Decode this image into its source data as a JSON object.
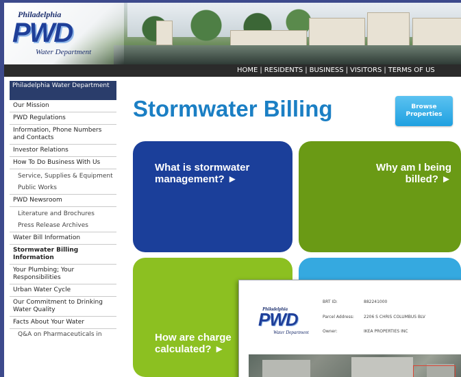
{
  "header": {
    "logo": {
      "top": "Philadelphia",
      "main": "PWD",
      "bottom": "Water Department"
    },
    "nav": [
      "HOME",
      "RESIDENTS",
      "BUSINESS",
      "VISITORS",
      "TERMS OF US"
    ]
  },
  "sidebar": {
    "heading": "Philadelphia Water Department",
    "items": [
      {
        "label": "Our Mission",
        "sub": false
      },
      {
        "label": "PWD Regulations",
        "sub": false
      },
      {
        "label": "Information, Phone Numbers and Contacts",
        "sub": false
      },
      {
        "label": "Investor Relations",
        "sub": false
      },
      {
        "label": "How To Do Business With Us",
        "sub": false
      },
      {
        "label": "Service, Supplies & Equipment",
        "sub": true
      },
      {
        "label": "Public Works",
        "sub": true
      },
      {
        "label": "PWD Newsroom",
        "sub": false
      },
      {
        "label": "Literature and Brochures",
        "sub": true
      },
      {
        "label": "Press Release Archives",
        "sub": true
      },
      {
        "label": "Water Bill Information",
        "sub": false
      },
      {
        "label": "Stormwater Billing Information",
        "sub": false,
        "active": true
      },
      {
        "label": "Your Plumbing; Your Responsibilities",
        "sub": false
      },
      {
        "label": "Urban Water Cycle",
        "sub": false
      },
      {
        "label": "Our Commitment to Drinking Water Quality",
        "sub": false
      },
      {
        "label": "Facts About Your Water",
        "sub": false
      },
      {
        "label": "Q&A on Pharmaceuticals in",
        "sub": true
      }
    ]
  },
  "main": {
    "title": "Stormwater Billing",
    "browse_button": "Browse Properties",
    "tiles": [
      {
        "text": "What is stormwater management? ►",
        "color": "#1b3f9a"
      },
      {
        "text": "Why am I being billed? ►",
        "color": "#6a9a15"
      },
      {
        "text": "How are charge calculated? ►",
        "color": "#8cc021"
      },
      {
        "text": "",
        "color": "#35a9e0"
      }
    ]
  },
  "card": {
    "logo": {
      "top": "Philadelphia",
      "main": "PWD",
      "bottom": "Water Department"
    },
    "fields": [
      {
        "key": "BRT ID:",
        "value": "882241000"
      },
      {
        "key": "Parcel Address:",
        "value": "2206 S CHRIS COLUMBUS BLV"
      },
      {
        "key": "Owner:",
        "value": "IKEA PROPERTIES INC"
      }
    ]
  },
  "colors": {
    "nav_bg": "#2b2b2b",
    "sidebar_head": "#2a3d6b",
    "title": "#1b7fc4",
    "frame": "#3d4a8c"
  }
}
